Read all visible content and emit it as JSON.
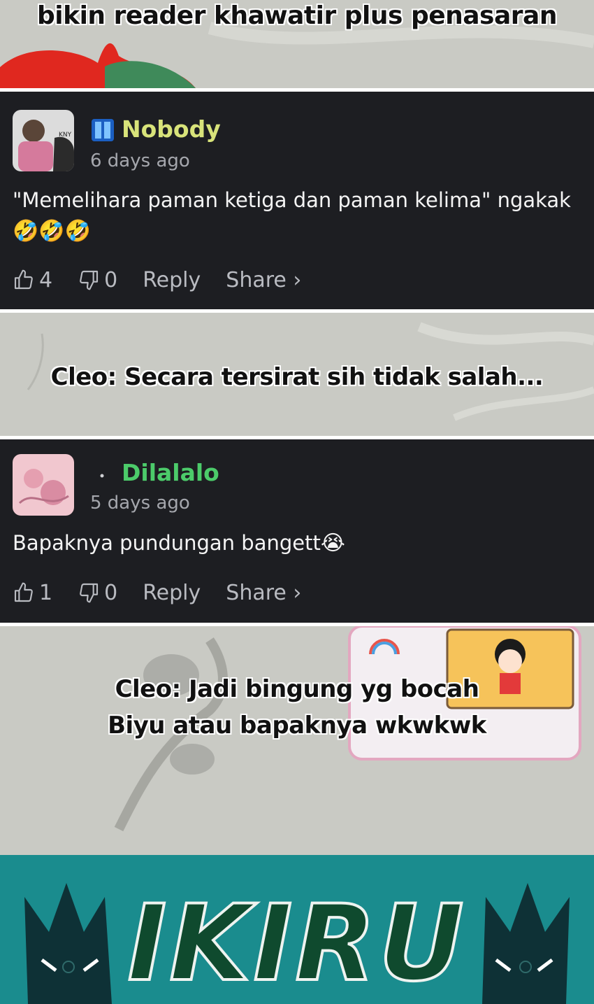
{
  "captions": {
    "top": "bikin reader khawatir plus penasaran",
    "middle": "Cleo: Secara tersirat sih tidak salah...",
    "bottom_line1": "Cleo: Jadi bingung yg bocah",
    "bottom_line2": "Biyu atau bapaknya wkwkwk"
  },
  "comments": [
    {
      "username": "Nobody",
      "username_color": "#d8e37a",
      "time": "6 days ago",
      "text": "\"Memelihara paman ketiga dan paman kelima\" ngakak",
      "emoji": "🤣🤣🤣",
      "likes": "4",
      "dislikes": "0",
      "reply_label": "Reply",
      "share_label": "Share ›",
      "badge_icon": "bookmark-badge-icon"
    },
    {
      "username": "Dilalalo",
      "username_color": "#4ccb6a",
      "time": "5 days ago",
      "text": "Bapaknya pundungan bangett",
      "emoji": "😭",
      "likes": "1",
      "dislikes": "0",
      "reply_label": "Reply",
      "share_label": "Share ›",
      "badge_icon": "dot-badge-icon"
    }
  ],
  "banner": {
    "title": "IKIRU",
    "background": "#1a8c8e"
  }
}
